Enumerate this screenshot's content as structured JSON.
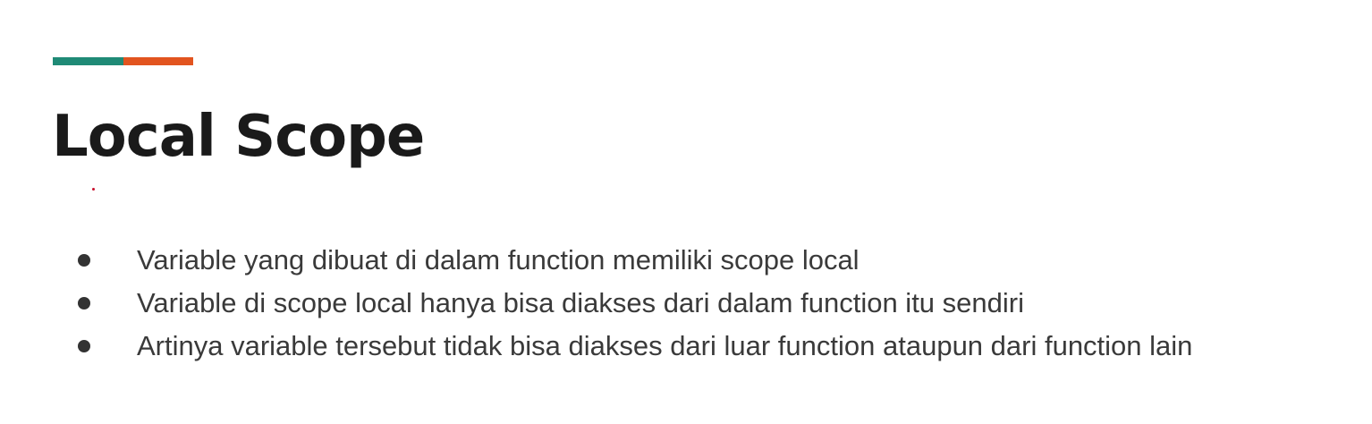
{
  "colors": {
    "accent_teal": "#1f8a76",
    "accent_orange": "#e2541f",
    "mark_red": "#c8102e"
  },
  "slide": {
    "title": "Local Scope",
    "bullets": [
      "Variable yang dibuat di dalam function memiliki scope local",
      "Variable di scope local hanya bisa diakses dari dalam function itu sendiri",
      "Artinya variable tersebut tidak bisa diakses dari luar function ataupun dari function lain"
    ]
  }
}
